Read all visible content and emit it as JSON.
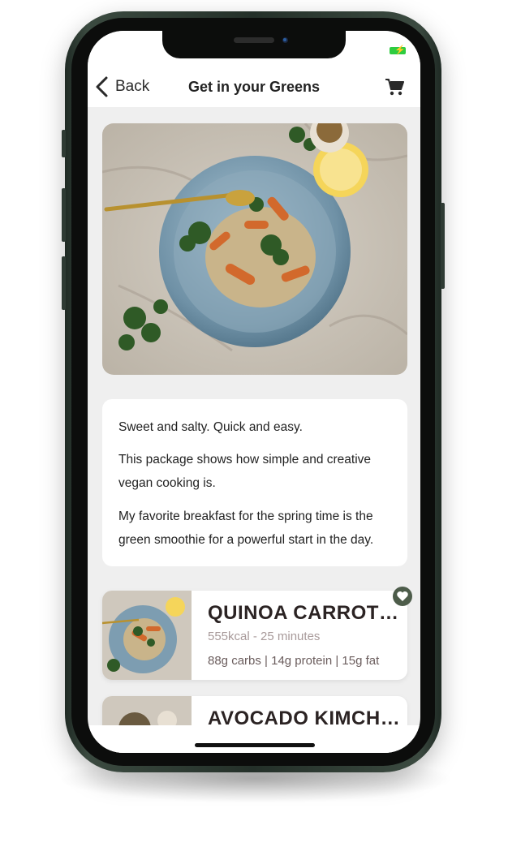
{
  "nav": {
    "back_label": "Back",
    "title": "Get in your Greens",
    "cart_icon": "cart-icon"
  },
  "status": {
    "battery_icon": "battery-charging-icon",
    "battery_color": "#2ecc40"
  },
  "hero": {
    "image": "bowl-of-quinoa-carrots-photo"
  },
  "description": {
    "paragraphs": [
      "Sweet and salty. Quick and easy.",
      "This package shows how simple and creative vegan cooking is.",
      "My favorite breakfast for the spring time is the green smoothie for a powerful start in the day."
    ]
  },
  "recipes": [
    {
      "title": "QUINOA CARROT BOWL",
      "subtitle": "555kcal - 25 minutes",
      "macros": "88g carbs | 14g protein | 15g fat",
      "favorite": true
    },
    {
      "title": "AVOCADO KIMCHI SALAD"
    }
  ],
  "colors": {
    "accent": "#4d5c4a",
    "title_text": "#2b2323",
    "muted_text": "#a89a9a"
  }
}
